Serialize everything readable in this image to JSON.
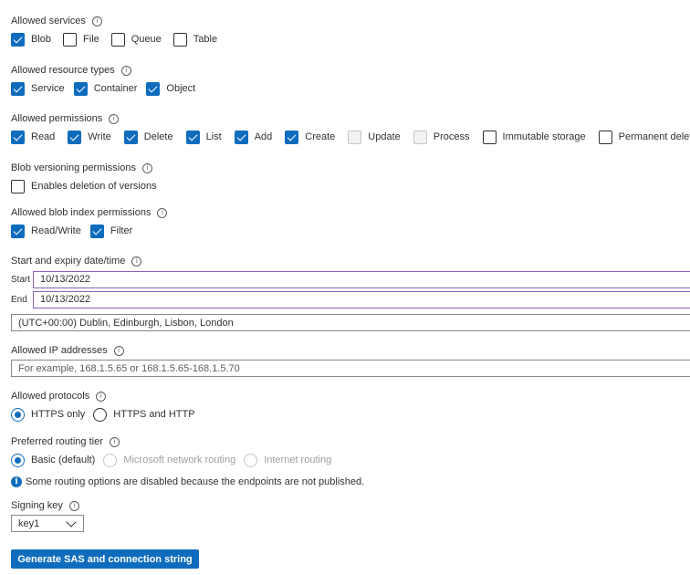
{
  "allowed_services": {
    "label": "Allowed services",
    "options": [
      {
        "label": "Blob",
        "checked": true
      },
      {
        "label": "File",
        "checked": false
      },
      {
        "label": "Queue",
        "checked": false
      },
      {
        "label": "Table",
        "checked": false
      }
    ]
  },
  "allowed_resource_types": {
    "label": "Allowed resource types",
    "options": [
      {
        "label": "Service",
        "checked": true
      },
      {
        "label": "Container",
        "checked": true
      },
      {
        "label": "Object",
        "checked": true
      }
    ]
  },
  "allowed_permissions": {
    "label": "Allowed permissions",
    "options": [
      {
        "label": "Read",
        "checked": true
      },
      {
        "label": "Write",
        "checked": true
      },
      {
        "label": "Delete",
        "checked": true
      },
      {
        "label": "List",
        "checked": true
      },
      {
        "label": "Add",
        "checked": true
      },
      {
        "label": "Create",
        "checked": true
      },
      {
        "label": "Update",
        "checked": false,
        "disabled": true
      },
      {
        "label": "Process",
        "checked": false,
        "disabled": true
      },
      {
        "label": "Immutable storage",
        "checked": false
      },
      {
        "label": "Permanent delete",
        "checked": false
      }
    ]
  },
  "blob_versioning": {
    "label": "Blob versioning permissions",
    "options": [
      {
        "label": "Enables deletion of versions",
        "checked": false
      }
    ]
  },
  "blob_index": {
    "label": "Allowed blob index permissions",
    "options": [
      {
        "label": "Read/Write",
        "checked": true
      },
      {
        "label": "Filter",
        "checked": true
      }
    ]
  },
  "dates": {
    "label": "Start and expiry date/time",
    "start_label": "Start",
    "start_value": "10/13/2022",
    "end_label": "End",
    "end_value": "10/13/2022",
    "timezone": "(UTC+00:00) Dublin, Edinburgh, Lisbon, London"
  },
  "ip": {
    "label": "Allowed IP addresses",
    "placeholder": "For example, 168.1.5.65 or 168.1.5.65-168.1.5.70"
  },
  "protocols": {
    "label": "Allowed protocols",
    "options": [
      {
        "label": "HTTPS only",
        "checked": true
      },
      {
        "label": "HTTPS and HTTP",
        "checked": false
      }
    ]
  },
  "routing": {
    "label": "Preferred routing tier",
    "options": [
      {
        "label": "Basic (default)",
        "checked": true,
        "disabled": false
      },
      {
        "label": "Microsoft network routing",
        "checked": false,
        "disabled": true
      },
      {
        "label": "Internet routing",
        "checked": false,
        "disabled": true
      }
    ],
    "note": "Some routing options are disabled because the endpoints are not published."
  },
  "signing_key": {
    "label": "Signing key",
    "selected": "key1"
  },
  "generate_button": "Generate SAS and connection string",
  "colors": {
    "accent": "#0f6cbd",
    "focus_border": "#8764b8"
  },
  "icons": {
    "info": "info-circle-icon",
    "chevron": "chevron-down-icon"
  }
}
